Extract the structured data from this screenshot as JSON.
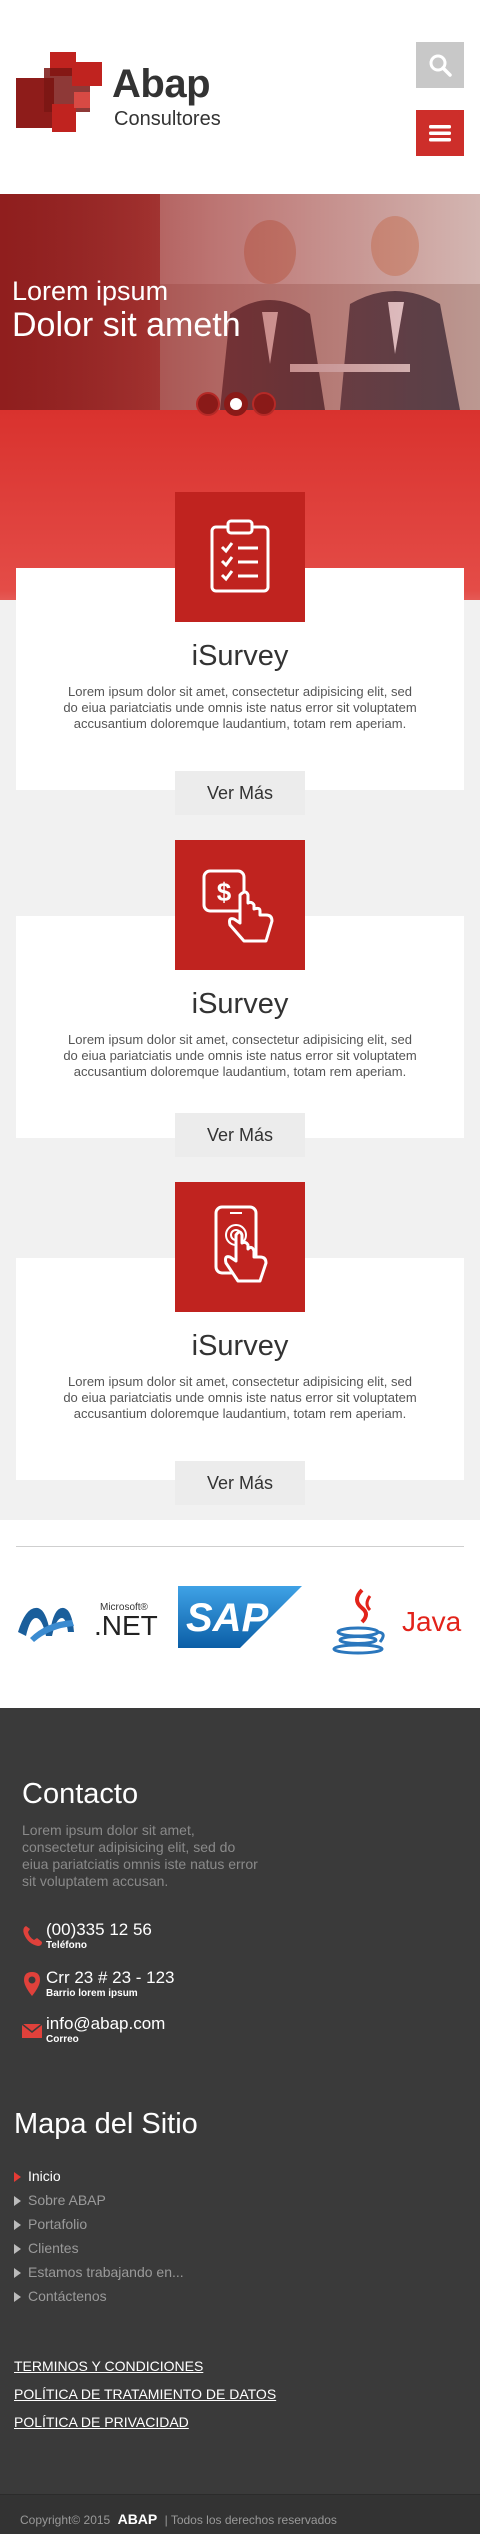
{
  "header": {
    "logo_main": "Abap",
    "logo_sub": "Consultores",
    "search_icon": "search-icon",
    "menu_icon": "hamburger-icon"
  },
  "hero": {
    "line1": "Lorem ipsum",
    "line2": "Dolor sit ameth",
    "slides_total": 3,
    "active_slide": 2
  },
  "services": [
    {
      "icon": "clipboard-checklist-icon",
      "title": "iSurvey",
      "text": "Lorem ipsum dolor sit amet, consectetur adipisicing elit, sed do eiua pariatciatis unde omnis iste natus error sit voluptatem accusantium doloremque laudantium, totam rem aperiam.",
      "button": "Ver Más"
    },
    {
      "icon": "dollar-touch-icon",
      "title": "iSurvey",
      "text": "Lorem ipsum dolor sit amet, consectetur adipisicing elit, sed do eiua pariatciatis unde omnis iste natus error sit voluptatem accusantium doloremque laudantium, totam rem aperiam.",
      "button": "Ver Más"
    },
    {
      "icon": "mobile-touch-icon",
      "title": "iSurvey",
      "text": "Lorem ipsum dolor sit amet, consectetur adipisicing elit, sed do eiua pariatciatis unde omnis iste natus error sit voluptatem accusantium doloremque laudantium, totam rem aperiam.",
      "button": "Ver Más"
    }
  ],
  "brands": {
    "net_small": "Microsoft®",
    "net_big": ".NET",
    "sap": "SAP",
    "java": "Java"
  },
  "footer": {
    "contact_title": "Contacto",
    "contact_desc": "Lorem ipsum dolor sit amet, consectetur adipisicing elit, sed do eiua pariatciatis omnis iste natus error sit voluptatem accusan.",
    "phone": "(00)335 12 56",
    "phone_label": "Teléfono",
    "address": "Crr 23 # 23 - 123",
    "address_label": "Barrio lorem ipsum",
    "email": "info@abap.com",
    "email_label": "Correo",
    "map_title": "Mapa del Sitio",
    "map_items": [
      "Inicio",
      "Sobre ABAP",
      "Portafolio",
      "Clientes",
      "Estamos trabajando en...",
      "Contáctenos"
    ],
    "legal": [
      "TERMINOS Y CONDICIONES",
      "POLÍTICA DE TRATAMIENTO DE DATOS",
      "POLÍTICA DE PRIVACIDAD"
    ],
    "copyright_pre": "Copyright© 2015",
    "copyright_brand": "ABAP",
    "copyright_post": "| Todos los derechos reservados"
  },
  "colors": {
    "brand_red": "#c0231f",
    "dark_footer": "#3a3a3a"
  }
}
